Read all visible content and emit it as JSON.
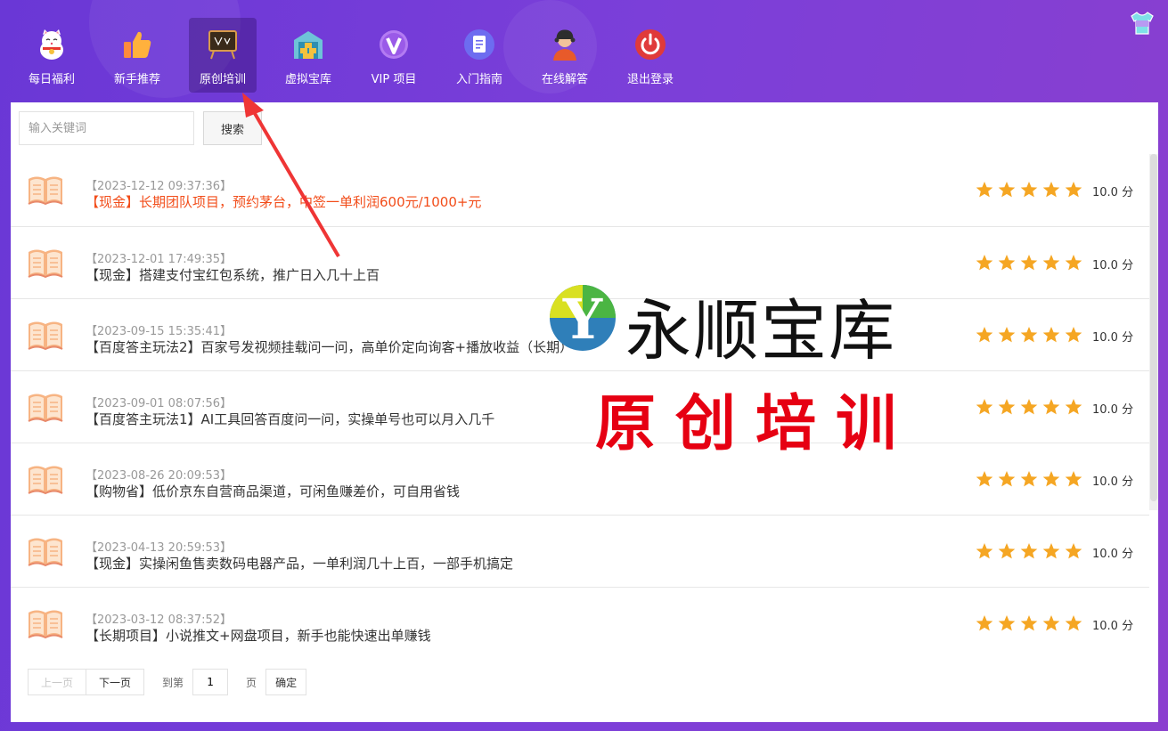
{
  "nav": {
    "items": [
      {
        "label": "每日福利",
        "icon": "lucky-cat-icon"
      },
      {
        "label": "新手推荐",
        "icon": "thumbs-up-icon"
      },
      {
        "label": "原创培训",
        "icon": "blackboard-icon",
        "active": true
      },
      {
        "label": "虚拟宝库",
        "icon": "warehouse-icon"
      },
      {
        "label": "VIP 项目",
        "icon": "vip-icon"
      },
      {
        "label": "入门指南",
        "icon": "document-icon"
      },
      {
        "label": "在线解答",
        "icon": "customer-service-icon"
      },
      {
        "label": "退出登录",
        "icon": "power-icon"
      }
    ]
  },
  "search": {
    "placeholder": "输入关键词",
    "button_label": "搜索"
  },
  "list": {
    "items": [
      {
        "date": "【2023-12-12 09:37:36】",
        "title": "【现金】长期团队项目，预约茅台，中签一单利润600元/1000+元",
        "hot": true,
        "stars": 5,
        "score": "10.0 分"
      },
      {
        "date": "【2023-12-01 17:49:35】",
        "title": "【现金】搭建支付宝红包系统，推广日入几十上百",
        "hot": false,
        "stars": 5,
        "score": "10.0 分"
      },
      {
        "date": "【2023-09-15 15:35:41】",
        "title": "【百度答主玩法2】百家号发视频挂载问一问，高单价定向询客+播放收益（长期）",
        "hot": false,
        "stars": 5,
        "score": "10.0 分"
      },
      {
        "date": "【2023-09-01 08:07:56】",
        "title": "【百度答主玩法1】AI工具回答百度问一问，实操单号也可以月入几千",
        "hot": false,
        "stars": 5,
        "score": "10.0 分"
      },
      {
        "date": "【2023-08-26 20:09:53】",
        "title": "【购物省】低价京东自营商品渠道，可闲鱼赚差价，可自用省钱",
        "hot": false,
        "stars": 5,
        "score": "10.0 分"
      },
      {
        "date": "【2023-04-13 20:59:53】",
        "title": "【现金】实操闲鱼售卖数码电器产品，一单利润几十上百，一部手机搞定",
        "hot": false,
        "stars": 5,
        "score": "10.0 分"
      },
      {
        "date": "【2023-03-12 08:37:52】",
        "title": "【长期项目】小说推文+网盘项目，新手也能快速出单赚钱",
        "hot": false,
        "stars": 5,
        "score": "10.0 分"
      }
    ]
  },
  "pager": {
    "prev_label": "上一页",
    "next_label": "下一页",
    "goto_prefix": "到第",
    "page_value": "1",
    "goto_suffix": "页",
    "confirm_label": "确定"
  },
  "watermark": {
    "logo_letter": "Y",
    "brand": "永顺宝库",
    "subtitle": "原创培训"
  },
  "colors": {
    "accent_purple": "#7b3fd9",
    "hot_title": "#f24d1a",
    "star": "#f5a623",
    "watermark_red": "#e60012"
  }
}
